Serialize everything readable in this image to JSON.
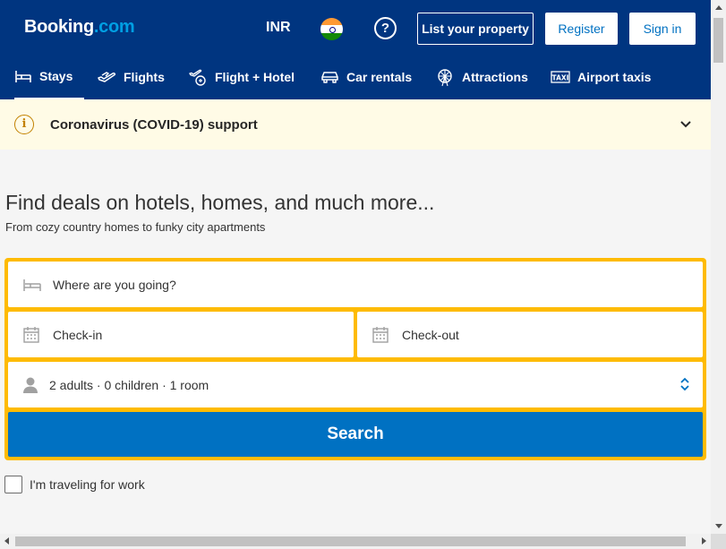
{
  "header": {
    "logo_main": "Booking",
    "logo_suffix": ".com",
    "currency": "INR",
    "flag_icon": "india-flag-icon",
    "help_glyph": "?",
    "list_property_label": "List your property",
    "register_label": "Register",
    "sign_in_label": "Sign in",
    "bg_color": "#003580"
  },
  "nav": {
    "items": [
      {
        "label": "Stays",
        "icon": "bed-icon",
        "active": true
      },
      {
        "label": "Flights",
        "icon": "plane-icon",
        "active": false
      },
      {
        "label": "Flight + Hotel",
        "icon": "flight-hotel-icon",
        "active": false
      },
      {
        "label": "Car rentals",
        "icon": "car-icon",
        "active": false
      },
      {
        "label": "Attractions",
        "icon": "ferris-wheel-icon",
        "active": false
      },
      {
        "label": "Airport taxis",
        "icon": "taxi-icon",
        "active": false
      }
    ]
  },
  "covid_banner": {
    "icon_glyph": "i",
    "text": "Coronavirus (COVID-19) support",
    "bg_color": "#fffbe6"
  },
  "hero": {
    "title": "Find deals on hotels, homes, and much more...",
    "subtitle": "From cozy country homes to funky city apartments"
  },
  "search": {
    "destination_placeholder": "Where are you going?",
    "checkin_label": "Check-in",
    "checkout_label": "Check-out",
    "guests_summary": "2 adults · 0 children · 1 room",
    "search_button": "Search",
    "border_color": "#febb02",
    "button_color": "#0071c2"
  },
  "work_travel": {
    "label": "I'm traveling for work",
    "checked": false
  }
}
